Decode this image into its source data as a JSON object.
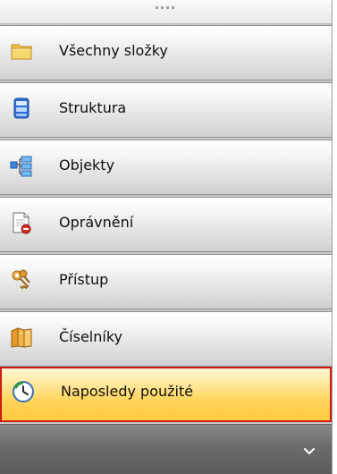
{
  "nav": {
    "items": [
      {
        "label": "Všechny složky",
        "icon": "folder-icon"
      },
      {
        "label": "Struktura",
        "icon": "structure-icon"
      },
      {
        "label": "Objekty",
        "icon": "objects-tree-icon"
      },
      {
        "label": "Oprávnění",
        "icon": "document-permission-icon"
      },
      {
        "label": "Přístup",
        "icon": "keys-icon"
      },
      {
        "label": "Číselníky",
        "icon": "books-icon"
      },
      {
        "label": "Naposledy použité",
        "icon": "recent-clock-icon",
        "selected": true
      }
    ]
  },
  "footer": {
    "chevron_icon": "chevron-down-icon"
  },
  "colors": {
    "selected_border": "#d01b13",
    "selected_fill": "#ffcb44"
  }
}
